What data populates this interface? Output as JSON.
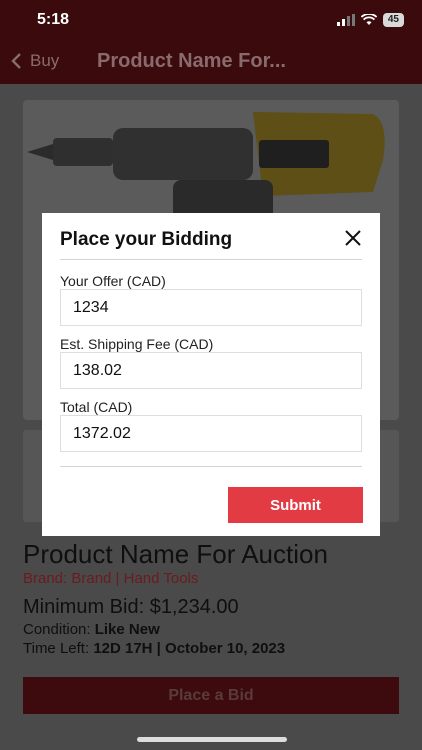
{
  "status_bar": {
    "time": "5:18",
    "battery": "45"
  },
  "nav": {
    "back_label": "Buy",
    "title": "Product Name For..."
  },
  "product": {
    "title": "Product Name For Auction",
    "brand_line": "Brand: Brand | Hand Tools",
    "min_bid": "Minimum Bid: $1,234.00",
    "condition_label": "Condition:",
    "condition_value": "Like New",
    "time_left_label": "Time Left:",
    "time_left_value": "12D 17H | October 10, 2023",
    "place_bid_label": "Place a Bid"
  },
  "modal": {
    "title": "Place your Bidding",
    "fields": [
      {
        "label": "Your Offer (CAD)",
        "value": "1234"
      },
      {
        "label": "Est. Shipping Fee (CAD)",
        "value": "138.02"
      },
      {
        "label": "Total (CAD)",
        "value": "1372.02"
      }
    ],
    "submit_label": "Submit"
  },
  "colors": {
    "brand": "#3a0a0c",
    "submit": "#e23b44",
    "overlay": "#4a4a4a"
  },
  "icons": [
    "chevron-left-icon",
    "close-icon",
    "signal-icon",
    "wifi-icon",
    "battery-icon"
  ]
}
